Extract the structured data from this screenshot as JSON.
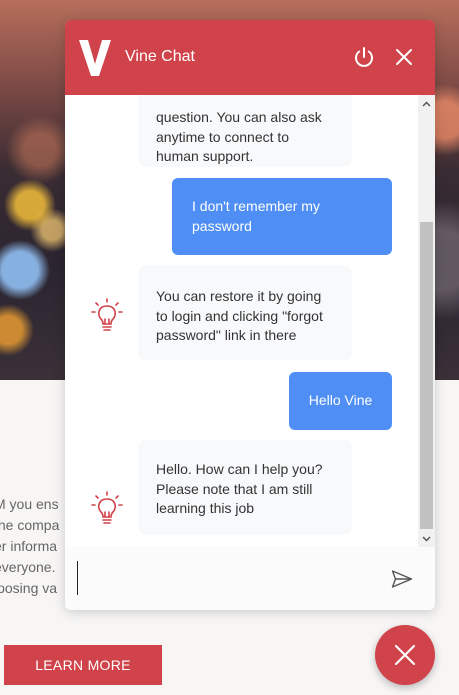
{
  "page": {
    "background_text_lines": [
      "M you ens",
      "the compa",
      "er informa",
      "everyone.",
      "loosing va"
    ],
    "learn_more_label": "LEARN MORE",
    "fab_icon": "close-icon"
  },
  "chat": {
    "title": "Vine Chat",
    "logo_icon": "vine-logo-icon",
    "header_buttons": {
      "power_icon": "power-icon",
      "close_icon": "close-icon"
    },
    "accent_color": "#d1434b",
    "user_bubble_color": "#4f8ff5",
    "messages": [
      {
        "sender": "bot",
        "lines": [
          "question. You can also ask",
          "anytime to connect to",
          "human support."
        ]
      },
      {
        "sender": "user",
        "lines": [
          "I don't remember my",
          "password"
        ]
      },
      {
        "sender": "bot",
        "icon": "lightbulb-icon",
        "lines": [
          "You can restore it by going",
          "to login and clicking \"forgot",
          "password\" link in there"
        ]
      },
      {
        "sender": "user",
        "lines": [
          "Hello Vine"
        ]
      },
      {
        "sender": "bot",
        "icon": "lightbulb-icon",
        "lines": [
          "Hello. How can I help you?",
          "Please note that I am still",
          "learning this job"
        ]
      }
    ],
    "composer": {
      "value": "",
      "placeholder": "",
      "send_icon": "send-icon"
    }
  }
}
